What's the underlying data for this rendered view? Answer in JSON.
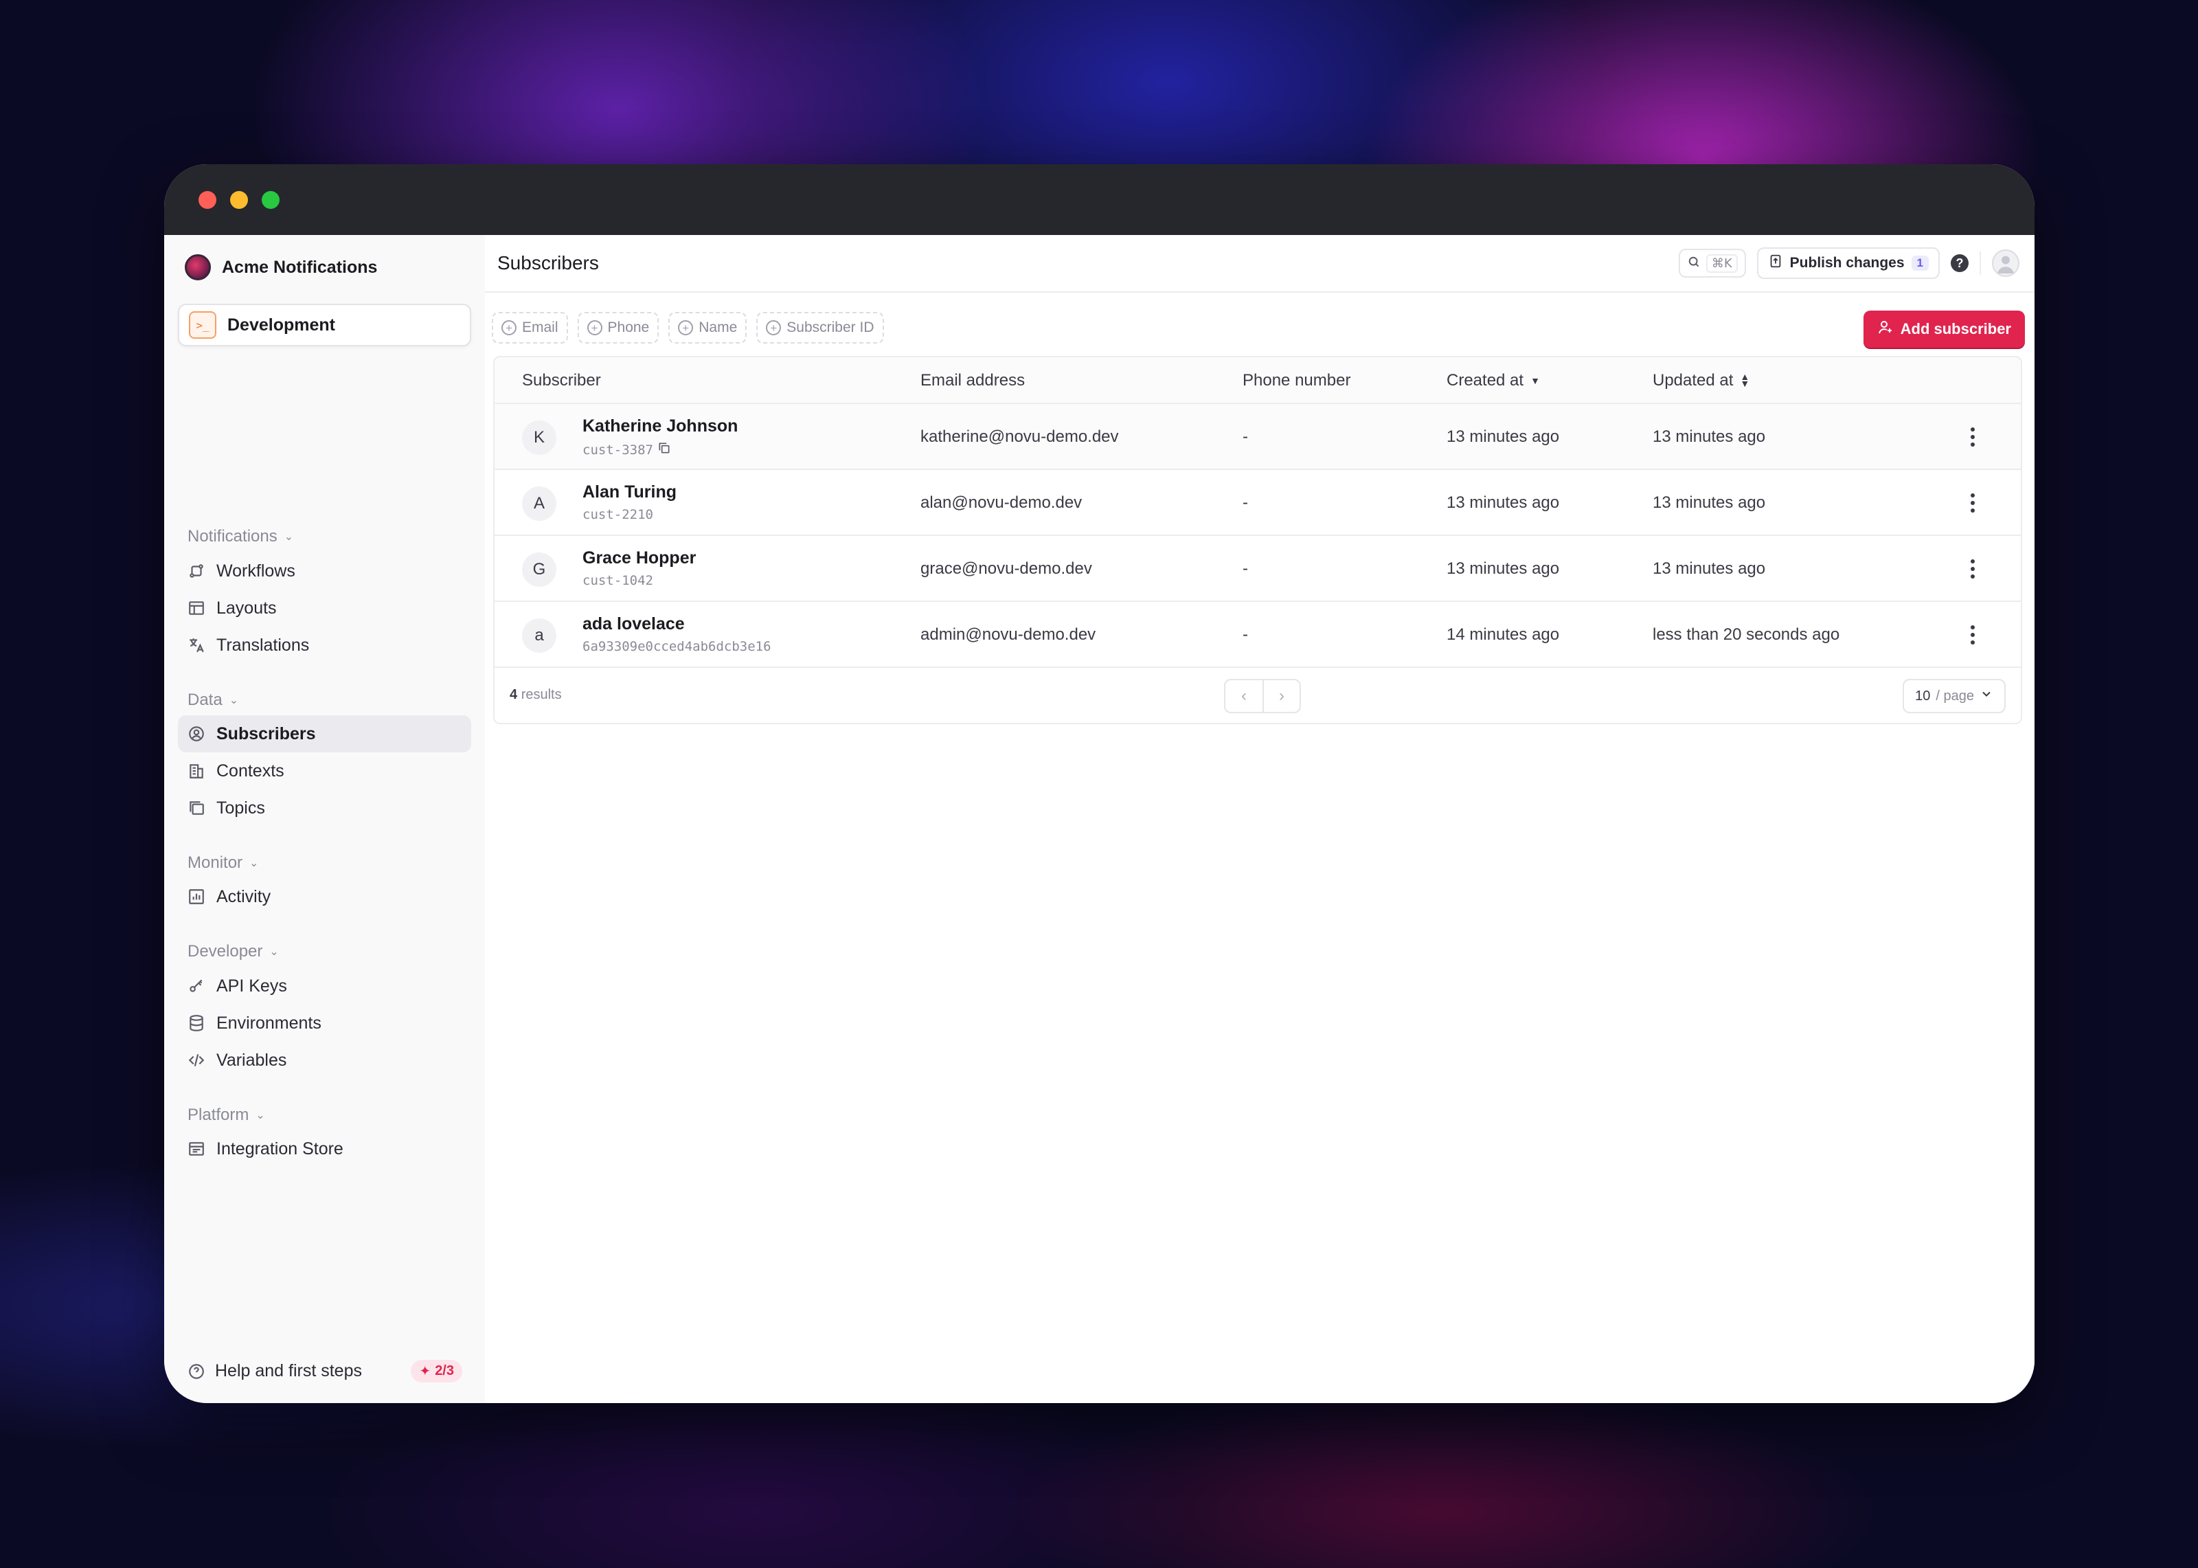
{
  "window": {
    "controls": [
      "close",
      "minimize",
      "maximize"
    ],
    "control_colors": {
      "close": "#fe5f57",
      "minimize": "#febc2e",
      "maximize": "#28c840"
    }
  },
  "sidebar": {
    "org_name": "Acme Notifications",
    "environment": "Development",
    "sections": [
      {
        "label": "Notifications",
        "items": [
          {
            "label": "Workflows",
            "icon": "workflow-icon"
          },
          {
            "label": "Layouts",
            "icon": "layout-icon"
          },
          {
            "label": "Translations",
            "icon": "translate-icon"
          }
        ]
      },
      {
        "label": "Data",
        "items": [
          {
            "label": "Subscribers",
            "icon": "subscribers-icon",
            "active": true
          },
          {
            "label": "Contexts",
            "icon": "building-icon"
          },
          {
            "label": "Topics",
            "icon": "topics-icon"
          }
        ]
      },
      {
        "label": "Monitor",
        "items": [
          {
            "label": "Activity",
            "icon": "activity-chart-icon"
          }
        ]
      },
      {
        "label": "Developer",
        "items": [
          {
            "label": "API Keys",
            "icon": "key-icon"
          },
          {
            "label": "Environments",
            "icon": "database-icon"
          },
          {
            "label": "Variables",
            "icon": "code-icon"
          }
        ]
      },
      {
        "label": "Platform",
        "items": [
          {
            "label": "Integration Store",
            "icon": "store-icon"
          }
        ]
      }
    ],
    "help": {
      "label": "Help and first steps",
      "progress": "2/3"
    }
  },
  "header": {
    "title": "Subscribers",
    "search_shortcut": "⌘K",
    "publish_label": "Publish changes",
    "publish_count": "1"
  },
  "filters": [
    {
      "label": "Email"
    },
    {
      "label": "Phone"
    },
    {
      "label": "Name"
    },
    {
      "label": "Subscriber ID"
    }
  ],
  "add_button_label": "Add subscriber",
  "accent_color": "#e0244e",
  "table": {
    "columns": [
      "Subscriber",
      "Email address",
      "Phone number",
      "Created at",
      "Updated at"
    ],
    "rows": [
      {
        "initial": "K",
        "name": "Katherine Johnson",
        "id": "cust-3387",
        "email": "katherine@novu-demo.dev",
        "phone": "-",
        "created": "13 minutes ago",
        "updated": "13 minutes ago"
      },
      {
        "initial": "A",
        "name": "Alan Turing",
        "id": "cust-2210",
        "email": "alan@novu-demo.dev",
        "phone": "-",
        "created": "13 minutes ago",
        "updated": "13 minutes ago"
      },
      {
        "initial": "G",
        "name": "Grace Hopper",
        "id": "cust-1042",
        "email": "grace@novu-demo.dev",
        "phone": "-",
        "created": "13 minutes ago",
        "updated": "13 minutes ago"
      },
      {
        "initial": "a",
        "name": "ada lovelace",
        "id": "6a93309e0cced4ab6dcb3e16",
        "email": "admin@novu-demo.dev",
        "phone": "-",
        "created": "14 minutes ago",
        "updated": "less than 20 seconds ago"
      }
    ],
    "results_count": "4",
    "results_label": "results",
    "per_page_value": "10",
    "per_page_unit": "/ page"
  }
}
